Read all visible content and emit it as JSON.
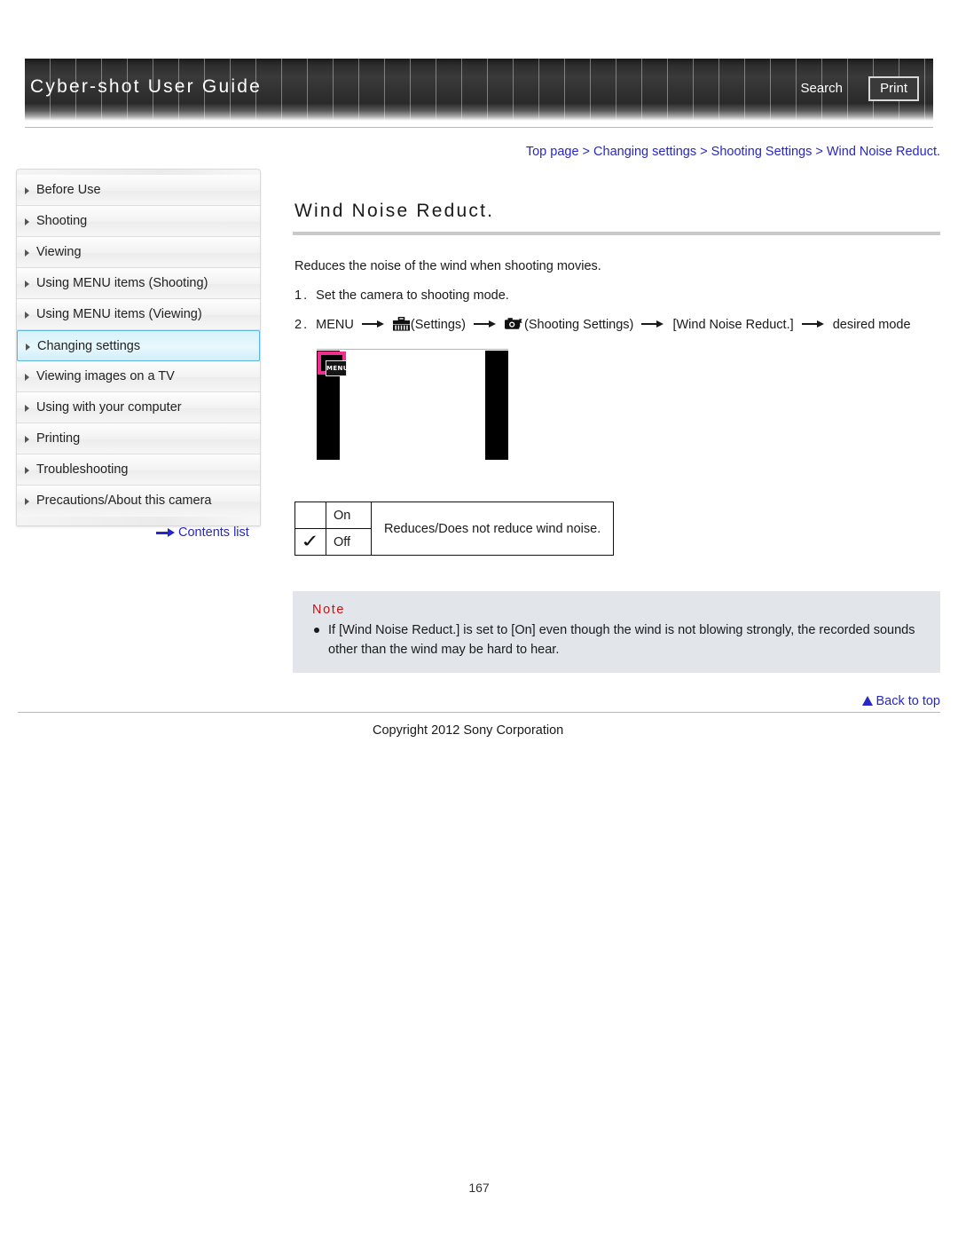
{
  "header": {
    "title": "Cyber-shot User Guide",
    "search_label": "Search",
    "print_label": "Print"
  },
  "breadcrumb": {
    "items": [
      "Top page",
      "Changing settings",
      "Shooting Settings",
      "Wind Noise Reduct."
    ],
    "separator": ">",
    "text": "Top page > Changing settings > Shooting Settings > Wind Noise Reduct."
  },
  "sidebar": {
    "items": [
      {
        "label": "Before Use",
        "active": false
      },
      {
        "label": "Shooting",
        "active": false
      },
      {
        "label": "Viewing",
        "active": false
      },
      {
        "label": "Using MENU items (Shooting)",
        "active": false
      },
      {
        "label": "Using MENU items (Viewing)",
        "active": false
      },
      {
        "label": "Changing settings",
        "active": true
      },
      {
        "label": "Viewing images on a TV",
        "active": false
      },
      {
        "label": "Using with your computer",
        "active": false
      },
      {
        "label": "Printing",
        "active": false
      },
      {
        "label": "Troubleshooting",
        "active": false
      },
      {
        "label": "Precautions/About this camera",
        "active": false
      }
    ],
    "contents_link": "Contents list"
  },
  "main": {
    "title": "Wind Noise Reduct.",
    "intro": "Reduces the noise of the wind when shooting movies.",
    "steps": [
      {
        "num": "1.",
        "text": "Set the camera to shooting mode."
      }
    ],
    "step2": {
      "num": "2.",
      "part1": "MENU",
      "icon1": "toolbox-settings-icon",
      "part2": "(Settings)",
      "icon2": "camera-shooting-settings-icon",
      "part3": "(Shooting Settings)",
      "part4": "[Wind Noise Reduct.]",
      "part5": "desired mode"
    },
    "illustration": {
      "name": "camera-screen-menu-illustration",
      "menu_button_label": "MENU"
    },
    "table": {
      "rows": [
        {
          "check": "",
          "option": "On",
          "desc": "Reduces/Does not reduce wind noise.",
          "desc_rowspan": 2
        },
        {
          "check": "✓",
          "option": "Off",
          "desc": ""
        }
      ]
    },
    "note": {
      "title": "Note",
      "items": [
        "If [Wind Noise Reduct.] is set to [On] even though the wind is not blowing strongly, the recorded sounds other than the wind may be hard to hear."
      ]
    }
  },
  "footer": {
    "back_to_top": "Back to top",
    "copyright": "Copyright 2012 Sony Corporation",
    "page_number": "167"
  },
  "colors": {
    "link_blue": "#2727c8",
    "note_red": "#cc1111",
    "highlight_cyan": "#d6f2fb",
    "highlight_magenta": "#ef2f8e",
    "note_bg": "#e2e5ea"
  }
}
